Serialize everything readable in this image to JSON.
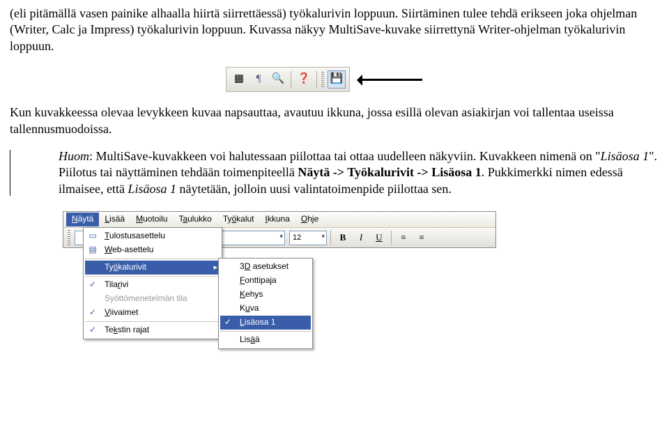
{
  "para1": "(eli pitämällä vasen painike alhaalla hiirtä siirrettäessä) työkalurivin loppuun. Siirtäminen tulee tehdä erikseen joka ohjelman (Writer, Calc ja Impress) työkalurivin loppuun. Kuvassa näkyy MultiSave-kuvake siirrettynä Writer-ohjelman työkalurivin loppuun.",
  "para2": "Kun kuvakkeessa olevaa levykkeen kuvaa napsauttaa, avautuu ikkuna, jossa esillä olevan asiakirjan voi tallentaa useissa tallennusmuodoissa.",
  "note": {
    "prefix": "Huom",
    "t1": ": MultiSave-kuvakkeen voi halutessaan piilottaa tai ottaa uudelleen näkyviin. Kuvakkeen nimenä on \"",
    "em1": "Lisäosa 1",
    "t2": "\". Piilotus tai näyttäminen tehdään toimenpiteellä ",
    "b1": "Näytä -> Työkalurivit -> Lisäosa 1",
    "t3": ". Pukkimerkki nimen edessä ilmaisee, että ",
    "em2": "Lisäosa 1",
    "t4": " näytetään, jolloin uusi valintatoimenpide piilottaa sen."
  },
  "menubar": {
    "items": [
      {
        "pre": "",
        "ul": "N",
        "post": "äytä"
      },
      {
        "pre": "",
        "ul": "L",
        "post": "isää"
      },
      {
        "pre": "",
        "ul": "M",
        "post": "uotoilu"
      },
      {
        "pre": "T",
        "ul": "a",
        "post": "ulukko"
      },
      {
        "pre": "Ty",
        "ul": "ö",
        "post": "kalut"
      },
      {
        "pre": "",
        "ul": "I",
        "post": "kkuna"
      },
      {
        "pre": "",
        "ul": "O",
        "post": "hje"
      }
    ]
  },
  "fmt": {
    "size": "12"
  },
  "menu1": {
    "items": [
      {
        "label": "Tulostusasettelu",
        "ul": "T",
        "icon": "▭"
      },
      {
        "label": "Web-asettelu",
        "ul": "W",
        "icon": "▤"
      },
      {
        "label": "Työkalurivit",
        "ul": "ö",
        "icon": "",
        "hilite": true,
        "sub": true
      },
      {
        "label": "Tilarivi",
        "ul": "r",
        "icon": "",
        "check": true
      },
      {
        "label": "Syöttömenetelmän tila",
        "ul": "",
        "icon": "",
        "disabled": true
      },
      {
        "label": "Viivaimet",
        "ul": "V",
        "icon": "",
        "check": true
      },
      {
        "label": "Tekstin rajat",
        "ul": "k",
        "icon": "",
        "check": true
      }
    ]
  },
  "menu2": {
    "items": [
      {
        "label": "3D asetukset",
        "ul": "D"
      },
      {
        "label": "Fonttipaja",
        "ul": "F"
      },
      {
        "label": "Kehys",
        "ul": "K"
      },
      {
        "label": "Kuva",
        "ul": "u"
      },
      {
        "label": "Lisäosa 1",
        "ul": "L",
        "hilite": true,
        "check": true
      },
      {
        "label": "Lisää",
        "ul": "ä"
      }
    ]
  }
}
